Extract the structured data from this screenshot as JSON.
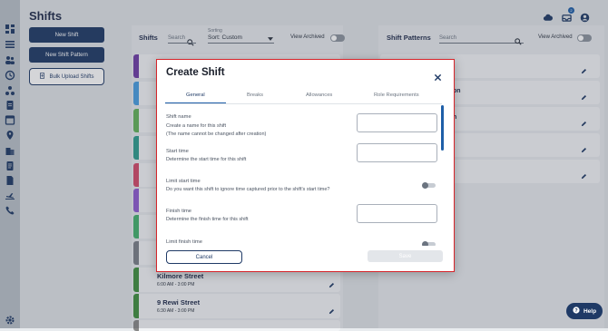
{
  "page": {
    "title": "Shifts"
  },
  "left_buttons": {
    "new_shift": "New Shift",
    "new_shift_pattern": "New Shift Pattern",
    "bulk_upload": "Bulk Upload Shifts"
  },
  "shifts_panel": {
    "title": "Shifts",
    "search_placeholder": "Search",
    "sorting_label": "Sorting",
    "sort_value": "Sort: Custom",
    "view_archived": "View Archived",
    "cards": [
      {
        "name": "Kilmore Street",
        "time": "6:00 AM - 3:00 PM",
        "color": "#3f8f3f"
      },
      {
        "name": "9 Rewi Street",
        "time": "6:30 AM - 3:00 PM",
        "color": "#3f8f3f"
      }
    ],
    "stripe_colors": [
      "#6f3da6",
      "#4a9ee0",
      "#63b35a",
      "#2f9d8f",
      "#d34a6a",
      "#8f5bd0",
      "#43b16e",
      "#7a7f88",
      "#3f8f3f",
      "#3f8f3f",
      "#888888"
    ]
  },
  "patterns_panel": {
    "title": "Shift Patterns",
    "search_placeholder": "Search",
    "view_archived": "View Archived",
    "cards": [
      {
        "name": ""
      },
      {
        "name": "on"
      },
      {
        "name": "n"
      },
      {
        "name": ""
      },
      {
        "name": ""
      }
    ]
  },
  "modal": {
    "title": "Create Shift",
    "tabs": [
      "General",
      "Breaks",
      "Allowances",
      "Role Requirements"
    ],
    "active_tab": "General",
    "fields": {
      "shift_name": {
        "label": "Shift name",
        "desc1": "Create a name for this shift",
        "desc2": "(The name cannot be changed after creation)",
        "value": ""
      },
      "start_time": {
        "label": "Start time",
        "desc1": "Determine the start time for this shift",
        "value": ""
      },
      "limit_start": {
        "label": "Limit start time",
        "desc1": "Do you want this shift to ignore time captured prior to the shift's start time?",
        "on": false
      },
      "finish_time": {
        "label": "Finish time",
        "desc1": "Determine the finish time for this shift",
        "value": ""
      },
      "limit_finish": {
        "label": "Limit finish time"
      }
    },
    "cancel_label": "Cancel",
    "save_label": "Save"
  },
  "top_right": {
    "notification_count": "2"
  },
  "help": {
    "label": "Help"
  },
  "colors": {
    "primary": "#1f3a66",
    "accent": "#1f5fa8",
    "modal_border": "#d6252b"
  }
}
